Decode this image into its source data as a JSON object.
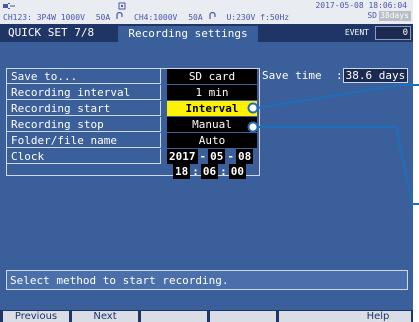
{
  "status_bar": {
    "connection": "CH123:  3P4W   1000V",
    "ch1_range": "50A",
    "ch4": "CH4:1000V",
    "ch4_range": "50A",
    "voltage_freq": "U:230V f:50Hz",
    "datetime": "2017-05-08 18:06:04",
    "sd_label": "SD",
    "days_remaining": "38days"
  },
  "title_bar": {
    "quickset": "QUICK SET 7/8",
    "tab": "Recording settings",
    "event_label": "EVENT",
    "event_count": "0"
  },
  "settings": [
    {
      "label": "Save to...",
      "value": "SD card",
      "selected": false
    },
    {
      "label": "Recording interval",
      "value": "1 min",
      "selected": false
    },
    {
      "label": "Recording start",
      "value": "Interval",
      "selected": true
    },
    {
      "label": "Recording stop",
      "value": "Manual",
      "selected": false
    },
    {
      "label": "Folder/file name",
      "value": "Auto",
      "selected": false
    }
  ],
  "clock": {
    "label": "Clock",
    "year": "2017",
    "month": "05",
    "day": "08",
    "hour": "18",
    "minute": "06",
    "second": "00",
    "date_sep": "-",
    "time_sep": ":"
  },
  "save_time": {
    "label": "Save time",
    "prefix": ":",
    "value": "38.6 days"
  },
  "hint": "Select method to start recording.",
  "softkeys": [
    "Previous",
    "Next",
    "",
    "",
    "",
    "Help"
  ],
  "colors": {
    "screen_bg": "#3a5f9b",
    "title_bg": "#1f3566",
    "highlight": "#fff200",
    "callout": "#1e6fb8"
  }
}
